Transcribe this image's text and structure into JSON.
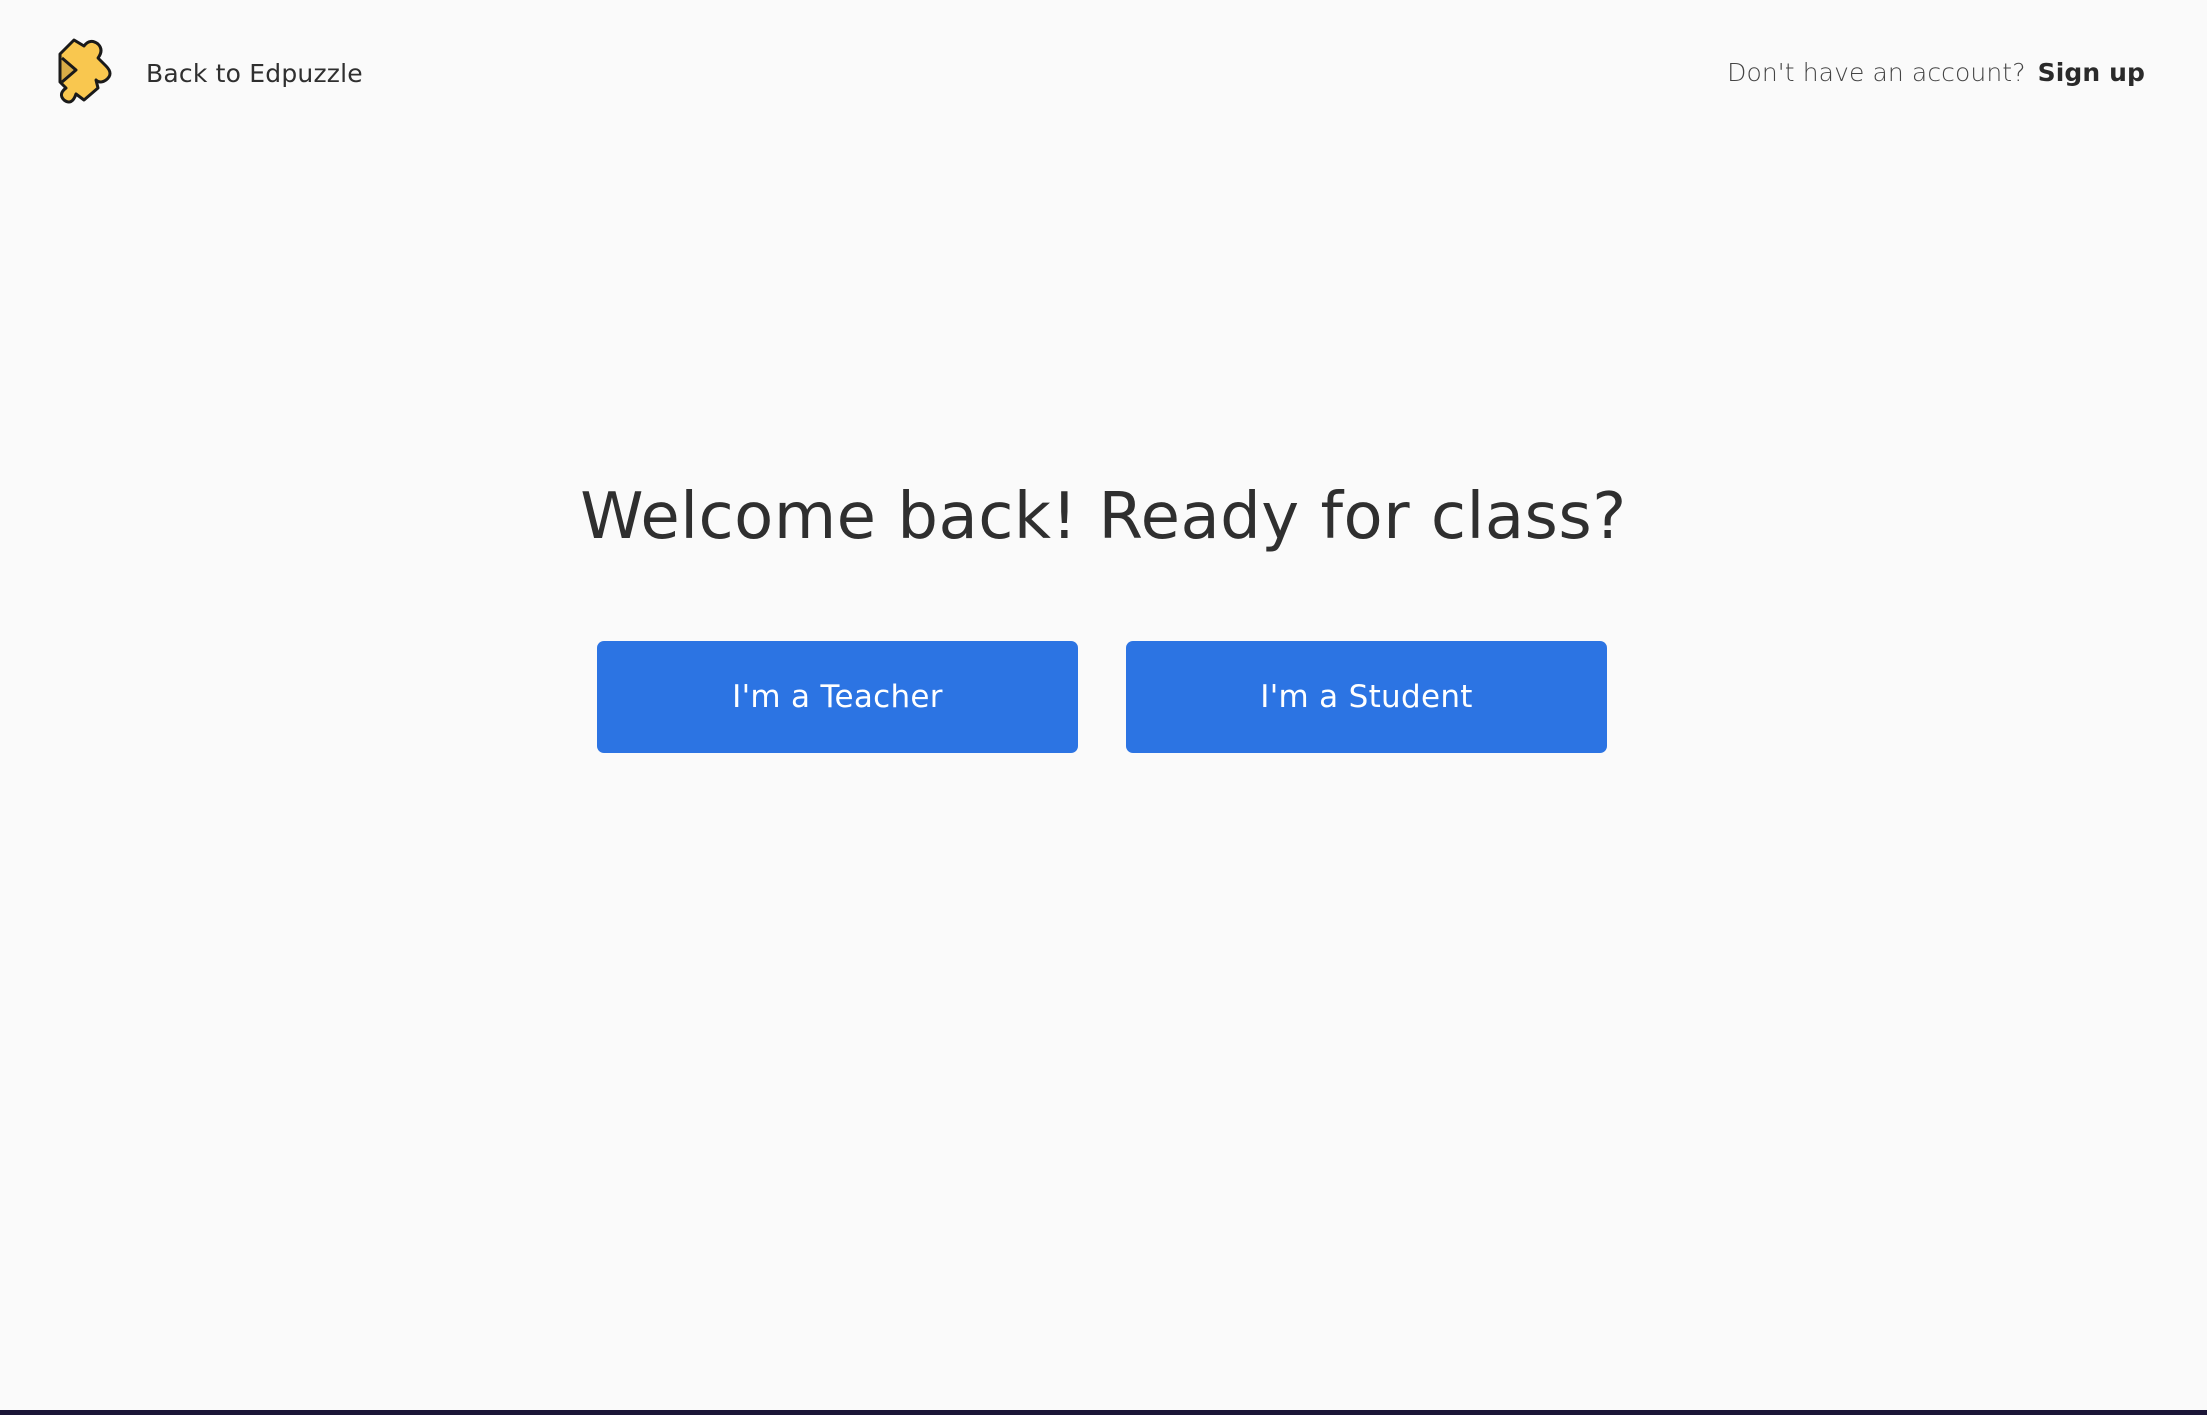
{
  "header": {
    "back_label": "Back to Edpuzzle",
    "account_prompt": "Don't have an account?",
    "signup_label": "Sign up"
  },
  "hero": {
    "title": "Welcome back! Ready for class?"
  },
  "roles": {
    "teacher_label": "I'm a Teacher",
    "student_label": "I'm a Student"
  },
  "colors": {
    "background": "#fafafa",
    "button": "#2c74e3",
    "logo_yellow": "#f9c74f",
    "text": "#2f2f2f"
  },
  "icons": {
    "logo": "edpuzzle-puzzle-logo-icon"
  }
}
